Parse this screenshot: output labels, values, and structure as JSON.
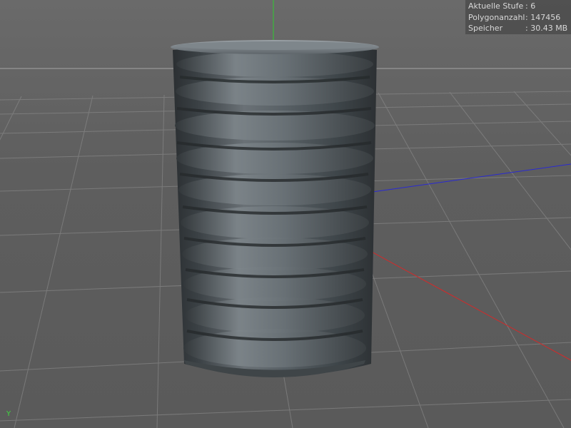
{
  "hud": {
    "rows": [
      {
        "key": "Aktuelle Stufe",
        "value": ": 6"
      },
      {
        "key": "Polygonanzahl",
        "value": ": 147456"
      },
      {
        "key": "Speicher",
        "value": ": 30.43 MB"
      }
    ]
  },
  "axis": {
    "y_label": "Y",
    "x_color": "#d22a2a",
    "y_color": "#2ecc2e",
    "z_color": "#2a2ad2"
  },
  "object": {
    "name": "bellows-cylinder",
    "color": "#4b5257",
    "rib_count": 9
  }
}
